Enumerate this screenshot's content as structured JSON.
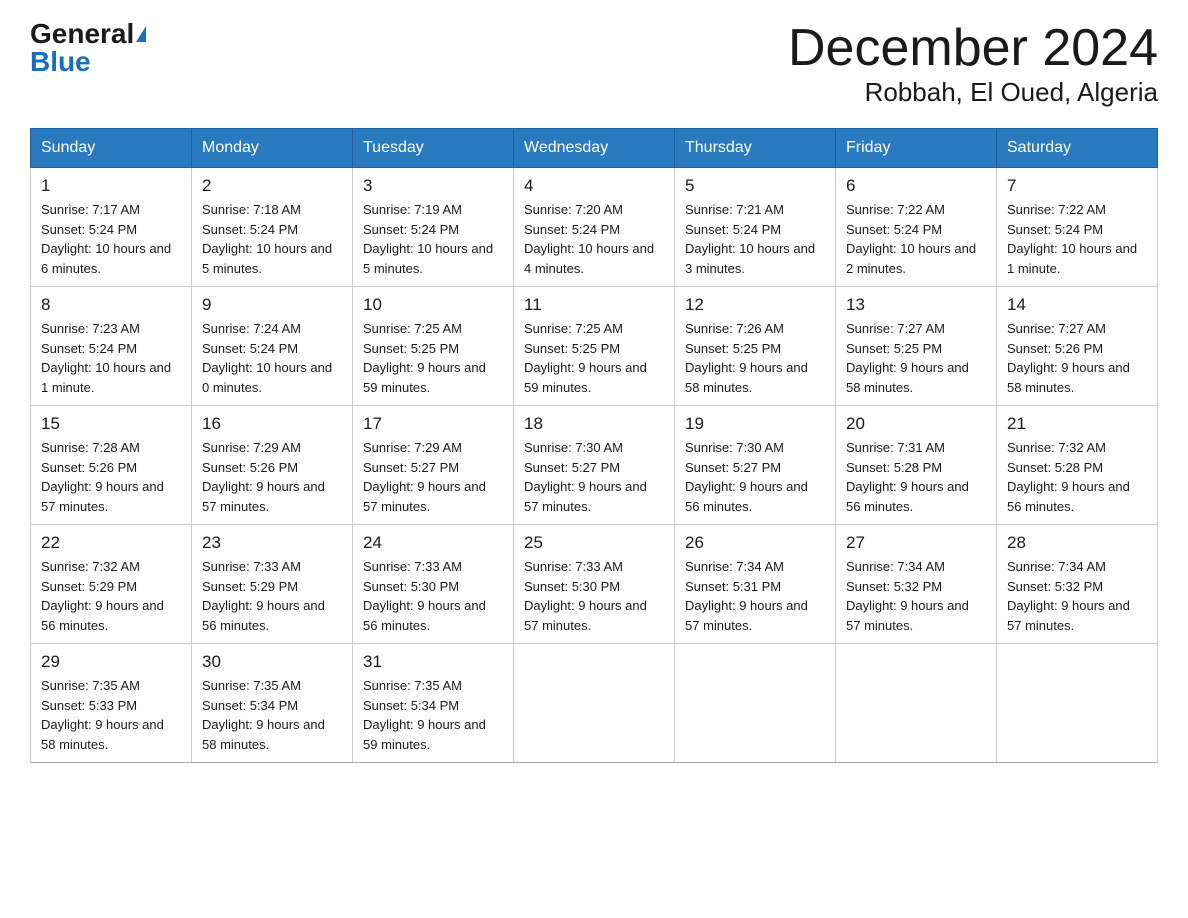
{
  "header": {
    "logo_general": "General",
    "logo_blue": "Blue",
    "month_title": "December 2024",
    "location": "Robbah, El Oued, Algeria"
  },
  "days_of_week": [
    "Sunday",
    "Monday",
    "Tuesday",
    "Wednesday",
    "Thursday",
    "Friday",
    "Saturday"
  ],
  "weeks": [
    [
      {
        "day": "1",
        "sunrise": "7:17 AM",
        "sunset": "5:24 PM",
        "daylight": "10 hours and 6 minutes."
      },
      {
        "day": "2",
        "sunrise": "7:18 AM",
        "sunset": "5:24 PM",
        "daylight": "10 hours and 5 minutes."
      },
      {
        "day": "3",
        "sunrise": "7:19 AM",
        "sunset": "5:24 PM",
        "daylight": "10 hours and 5 minutes."
      },
      {
        "day": "4",
        "sunrise": "7:20 AM",
        "sunset": "5:24 PM",
        "daylight": "10 hours and 4 minutes."
      },
      {
        "day": "5",
        "sunrise": "7:21 AM",
        "sunset": "5:24 PM",
        "daylight": "10 hours and 3 minutes."
      },
      {
        "day": "6",
        "sunrise": "7:22 AM",
        "sunset": "5:24 PM",
        "daylight": "10 hours and 2 minutes."
      },
      {
        "day": "7",
        "sunrise": "7:22 AM",
        "sunset": "5:24 PM",
        "daylight": "10 hours and 1 minute."
      }
    ],
    [
      {
        "day": "8",
        "sunrise": "7:23 AM",
        "sunset": "5:24 PM",
        "daylight": "10 hours and 1 minute."
      },
      {
        "day": "9",
        "sunrise": "7:24 AM",
        "sunset": "5:24 PM",
        "daylight": "10 hours and 0 minutes."
      },
      {
        "day": "10",
        "sunrise": "7:25 AM",
        "sunset": "5:25 PM",
        "daylight": "9 hours and 59 minutes."
      },
      {
        "day": "11",
        "sunrise": "7:25 AM",
        "sunset": "5:25 PM",
        "daylight": "9 hours and 59 minutes."
      },
      {
        "day": "12",
        "sunrise": "7:26 AM",
        "sunset": "5:25 PM",
        "daylight": "9 hours and 58 minutes."
      },
      {
        "day": "13",
        "sunrise": "7:27 AM",
        "sunset": "5:25 PM",
        "daylight": "9 hours and 58 minutes."
      },
      {
        "day": "14",
        "sunrise": "7:27 AM",
        "sunset": "5:26 PM",
        "daylight": "9 hours and 58 minutes."
      }
    ],
    [
      {
        "day": "15",
        "sunrise": "7:28 AM",
        "sunset": "5:26 PM",
        "daylight": "9 hours and 57 minutes."
      },
      {
        "day": "16",
        "sunrise": "7:29 AM",
        "sunset": "5:26 PM",
        "daylight": "9 hours and 57 minutes."
      },
      {
        "day": "17",
        "sunrise": "7:29 AM",
        "sunset": "5:27 PM",
        "daylight": "9 hours and 57 minutes."
      },
      {
        "day": "18",
        "sunrise": "7:30 AM",
        "sunset": "5:27 PM",
        "daylight": "9 hours and 57 minutes."
      },
      {
        "day": "19",
        "sunrise": "7:30 AM",
        "sunset": "5:27 PM",
        "daylight": "9 hours and 56 minutes."
      },
      {
        "day": "20",
        "sunrise": "7:31 AM",
        "sunset": "5:28 PM",
        "daylight": "9 hours and 56 minutes."
      },
      {
        "day": "21",
        "sunrise": "7:32 AM",
        "sunset": "5:28 PM",
        "daylight": "9 hours and 56 minutes."
      }
    ],
    [
      {
        "day": "22",
        "sunrise": "7:32 AM",
        "sunset": "5:29 PM",
        "daylight": "9 hours and 56 minutes."
      },
      {
        "day": "23",
        "sunrise": "7:33 AM",
        "sunset": "5:29 PM",
        "daylight": "9 hours and 56 minutes."
      },
      {
        "day": "24",
        "sunrise": "7:33 AM",
        "sunset": "5:30 PM",
        "daylight": "9 hours and 56 minutes."
      },
      {
        "day": "25",
        "sunrise": "7:33 AM",
        "sunset": "5:30 PM",
        "daylight": "9 hours and 57 minutes."
      },
      {
        "day": "26",
        "sunrise": "7:34 AM",
        "sunset": "5:31 PM",
        "daylight": "9 hours and 57 minutes."
      },
      {
        "day": "27",
        "sunrise": "7:34 AM",
        "sunset": "5:32 PM",
        "daylight": "9 hours and 57 minutes."
      },
      {
        "day": "28",
        "sunrise": "7:34 AM",
        "sunset": "5:32 PM",
        "daylight": "9 hours and 57 minutes."
      }
    ],
    [
      {
        "day": "29",
        "sunrise": "7:35 AM",
        "sunset": "5:33 PM",
        "daylight": "9 hours and 58 minutes."
      },
      {
        "day": "30",
        "sunrise": "7:35 AM",
        "sunset": "5:34 PM",
        "daylight": "9 hours and 58 minutes."
      },
      {
        "day": "31",
        "sunrise": "7:35 AM",
        "sunset": "5:34 PM",
        "daylight": "9 hours and 59 minutes."
      },
      null,
      null,
      null,
      null
    ]
  ]
}
